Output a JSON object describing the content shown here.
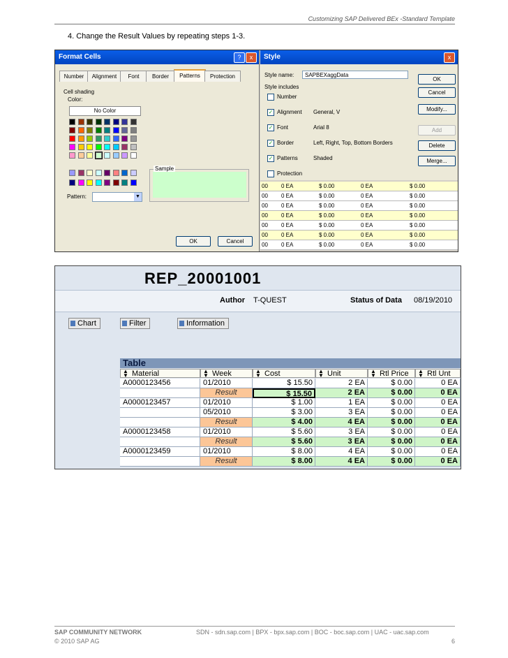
{
  "header": {
    "title": "Customizing SAP Delivered BEx -Standard Template"
  },
  "step": {
    "text": "4.   Change the Result Values by repeating steps 1-3."
  },
  "format_cells": {
    "title": "Format Cells",
    "help_icon": "?",
    "close_icon": "x",
    "tabs": [
      "Number",
      "Alignment",
      "Font",
      "Border",
      "Patterns",
      "Protection"
    ],
    "active_tab": "Patterns",
    "cell_shading": "Cell shading",
    "color_label": "Color:",
    "no_color": "No Color",
    "sample_label": "Sample",
    "pattern_label": "Pattern:",
    "ok": "OK",
    "cancel": "Cancel",
    "sample_color": "#ccffcc",
    "palette_rows": [
      [
        "#000000",
        "#993300",
        "#333300",
        "#003300",
        "#003366",
        "#000080",
        "#333399",
        "#333333"
      ],
      [
        "#800000",
        "#ff6600",
        "#808000",
        "#008000",
        "#008080",
        "#0000ff",
        "#666699",
        "#808080"
      ],
      [
        "#ff0000",
        "#ff9900",
        "#99cc00",
        "#339966",
        "#33cccc",
        "#3366ff",
        "#800080",
        "#969696"
      ],
      [
        "#ff00ff",
        "#ffcc00",
        "#ffff00",
        "#00ff00",
        "#00ffff",
        "#00ccff",
        "#993366",
        "#c0c0c0"
      ],
      [
        "#ff99cc",
        "#ffcc99",
        "#ffff99",
        "#ccffcc",
        "#ccffff",
        "#99ccff",
        "#cc99ff",
        "#ffffff"
      ]
    ],
    "palette_rows_lower": [
      [
        "#9999ff",
        "#993366",
        "#ffffcc",
        "#ccffff",
        "#660066",
        "#ff8080",
        "#0066cc",
        "#ccccff"
      ],
      [
        "#000080",
        "#ff00ff",
        "#ffff00",
        "#00ffff",
        "#800080",
        "#800000",
        "#008080",
        "#0000ff"
      ]
    ]
  },
  "style_dialog": {
    "title": "Style",
    "style_name_label": "Style name:",
    "style_name": "SAPBEXaggData",
    "style_includes": "Style includes",
    "rows": [
      {
        "label": "Number",
        "checked": false,
        "value": ""
      },
      {
        "label": "Alignment",
        "checked": true,
        "value": "General, V"
      },
      {
        "label": "Font",
        "checked": true,
        "value": "Arial 8"
      },
      {
        "label": "Border",
        "checked": true,
        "value": "Left, Right, Top, Bottom Borders"
      },
      {
        "label": "Patterns",
        "checked": true,
        "value": "Shaded"
      },
      {
        "label": "Protection",
        "checked": false,
        "value": ""
      }
    ],
    "ok": "OK",
    "cancel": "Cancel",
    "modify": "Modify...",
    "add": "Add",
    "delete": "Delete",
    "merge": "Merge..."
  },
  "excel_rows": [
    {
      "a": "00",
      "b": "0 EA",
      "c": "$ 0.00",
      "d": "0 EA",
      "e": "$ 0.00",
      "green": true
    },
    {
      "a": "00",
      "b": "0 EA",
      "c": "$ 0.00",
      "d": "0 EA",
      "e": "$ 0.00",
      "green": false
    },
    {
      "a": "00",
      "b": "0 EA",
      "c": "$ 0.00",
      "d": "0 EA",
      "e": "$ 0.00",
      "green": false
    },
    {
      "a": "00",
      "b": "0 EA",
      "c": "$ 0.00",
      "d": "0 EA",
      "e": "$ 0.00",
      "green": true
    },
    {
      "a": "00",
      "b": "0 EA",
      "c": "$ 0.00",
      "d": "0 EA",
      "e": "$ 0.00",
      "green": false
    },
    {
      "a": "00",
      "b": "0 EA",
      "c": "$ 0.00",
      "d": "0 EA",
      "e": "$ 0.00",
      "green": true
    },
    {
      "a": "00",
      "b": "0 EA",
      "c": "$ 0.00",
      "d": "0 EA",
      "e": "$ 0.00",
      "green": false
    }
  ],
  "report": {
    "title": "REP_20001001",
    "author_label": "Author",
    "author": "T-QUEST",
    "status_label": "Status of Data",
    "status_date": "08/19/2010",
    "buttons": [
      "Chart",
      "Filter",
      "Information"
    ],
    "table_label": "Table",
    "columns": [
      "Material",
      "Week",
      "Cost",
      "Unit",
      "Rtl Price",
      "Rtl Unt"
    ],
    "rows": [
      {
        "material": "A0000123456",
        "week": "01/2010",
        "cost": "$ 15.50",
        "unit": "2 EA",
        "price": "$ 0.00",
        "rtl": "0 EA",
        "result": false
      },
      {
        "material": "",
        "week": "Result",
        "cost": "$ 15.50",
        "unit": "2 EA",
        "price": "$ 0.00",
        "rtl": "0 EA",
        "result": true
      },
      {
        "material": "A0000123457",
        "week": "01/2010",
        "cost": "$ 1.00",
        "unit": "1 EA",
        "price": "$ 0.00",
        "rtl": "0 EA",
        "result": false
      },
      {
        "material": "",
        "week": "05/2010",
        "cost": "$ 3.00",
        "unit": "3 EA",
        "price": "$ 0.00",
        "rtl": "0 EA",
        "result": false
      },
      {
        "material": "",
        "week": "Result",
        "cost": "$ 4.00",
        "unit": "4 EA",
        "price": "$ 0.00",
        "rtl": "0 EA",
        "result": true
      },
      {
        "material": "A0000123458",
        "week": "01/2010",
        "cost": "$ 5.60",
        "unit": "3 EA",
        "price": "$ 0.00",
        "rtl": "0 EA",
        "result": false
      },
      {
        "material": "",
        "week": "Result",
        "cost": "$ 5.60",
        "unit": "3 EA",
        "price": "$ 0.00",
        "rtl": "0 EA",
        "result": true
      },
      {
        "material": "A0000123459",
        "week": "01/2010",
        "cost": "$ 8.00",
        "unit": "4 EA",
        "price": "$ 0.00",
        "rtl": "0 EA",
        "result": false
      },
      {
        "material": "",
        "week": "Result",
        "cost": "$ 8.00",
        "unit": "4 EA",
        "price": "$ 0.00",
        "rtl": "0 EA",
        "result": true
      }
    ]
  },
  "footer": {
    "network": "SAP COMMUNITY NETWORK",
    "links": "SDN - sdn.sap.com  |  BPX - bpx.sap.com  |  BOC - boc.sap.com  |  UAC - uac.sap.com",
    "copyright": "© 2010 SAP AG",
    "page": "6"
  }
}
